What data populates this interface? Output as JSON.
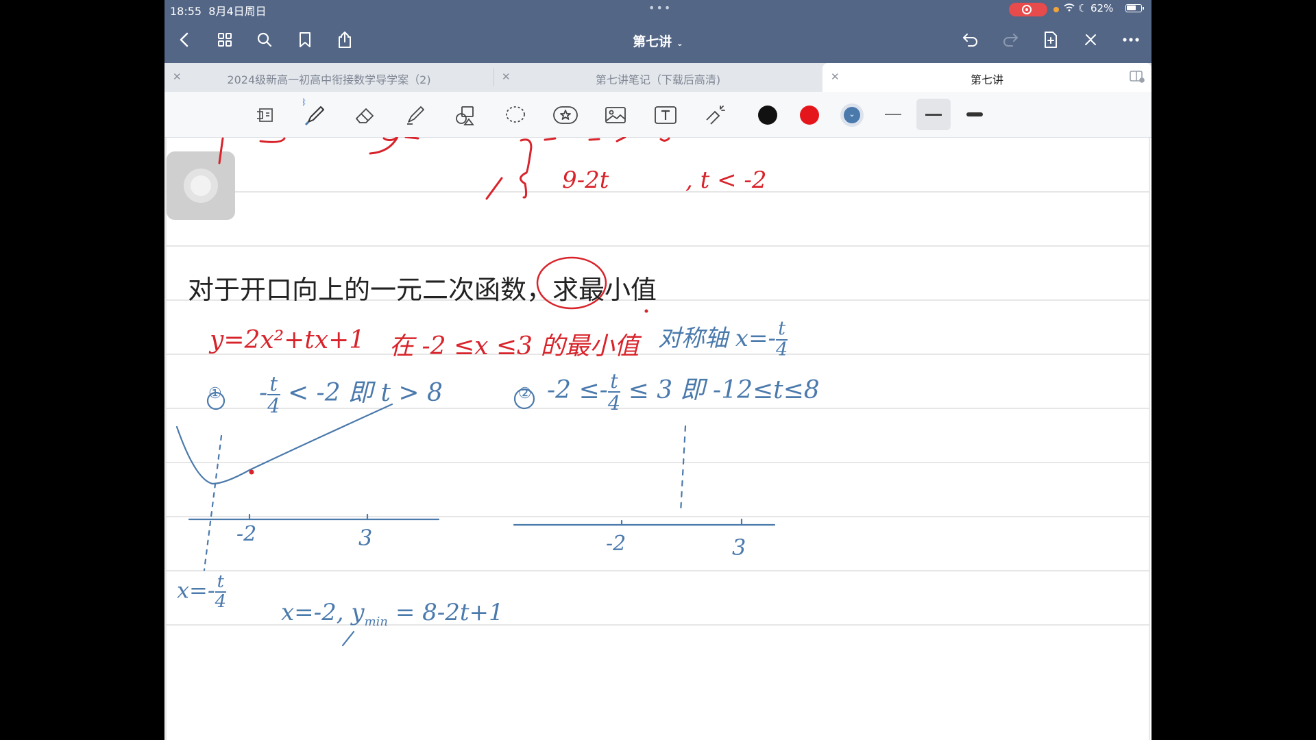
{
  "status": {
    "time": "18:55",
    "date": "8月4日周日",
    "battery": "62%"
  },
  "nav": {
    "title": "第七讲"
  },
  "tabs": [
    {
      "label": "2024级新高一初高中衔接数学导学案（2)"
    },
    {
      "label": "第七讲笔记（下载后高清)"
    },
    {
      "label": "第七讲"
    }
  ],
  "colors": {
    "black": "#111111",
    "red": "#e5161b",
    "blue": "#4a79ac"
  },
  "note": {
    "top_piece": "9-2t",
    "top_cond": "t < -2",
    "heading": "对于开口向上的一元二次函数，求最小值",
    "function": "y=2x²+tx+1",
    "domain": "在 -2 ≤x ≤3 的最小值",
    "axis_label": "对称轴 x=-",
    "case1_num": "①",
    "case1_left": "-",
    "case1_right": "< -2 即 t > 8",
    "case2_num": "②",
    "case2_left": "-2 ≤-",
    "case2_right": "≤ 3  即  -12≤t≤8",
    "frac_num": "t",
    "frac_den": "4",
    "tick_a": "-2",
    "tick_b": "3",
    "axis_x_label": "x=-",
    "result": "x=-2, y",
    "result_sub": "min",
    "result_rhs": "= 8-2t+1"
  }
}
